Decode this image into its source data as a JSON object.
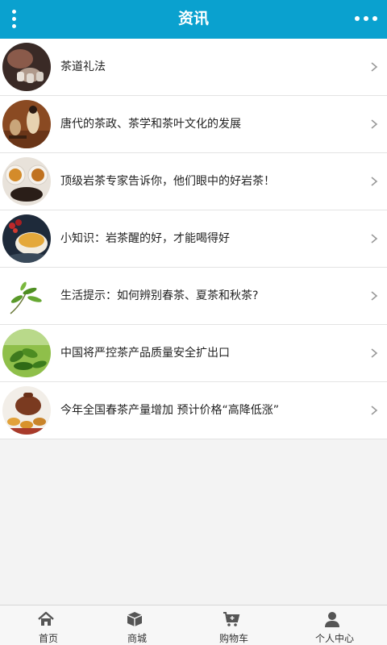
{
  "header": {
    "title": "资讯",
    "menu_icon": "vertical-dots-menu-icon",
    "more_icon": "horizontal-dots-more-icon",
    "background": "#0aa1cf"
  },
  "articles": [
    {
      "title": "茶道礼法",
      "thumb": "tea-ceremony-photo"
    },
    {
      "title": "唐代的茶政、茶学和茶叶文化的发展",
      "thumb": "tang-dynasty-painting-photo"
    },
    {
      "title": "顶级岩茶专家告诉你，他们眼中的好岩茶！",
      "thumb": "tea-cups-photo"
    },
    {
      "title": "小知识：岩茶醒的好，才能喝得好",
      "thumb": "tea-cup-berries-photo"
    },
    {
      "title": "生活提示：如何辨别春茶、夏茶和秋茶?",
      "thumb": "tea-leaves-photo"
    },
    {
      "title": "中国将严控茶产品质量安全扩出口",
      "thumb": "tea-field-photo"
    },
    {
      "title": "今年全国春茶产量增加 预计价格“高降低涨”",
      "thumb": "teapot-photo"
    }
  ],
  "tabbar": {
    "items": [
      {
        "label": "首页",
        "icon": "home-icon"
      },
      {
        "label": "商城",
        "icon": "box-icon"
      },
      {
        "label": "购物车",
        "icon": "cart-icon"
      },
      {
        "label": "个人中心",
        "icon": "user-icon"
      }
    ]
  }
}
